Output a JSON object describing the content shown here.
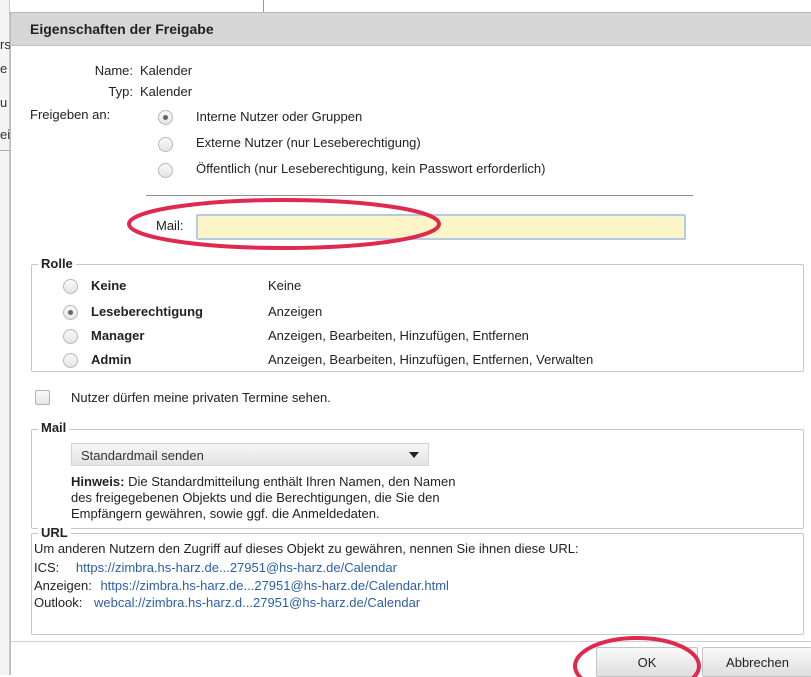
{
  "background": {
    "fragments": [
      "rs",
      "e",
      "u",
      "ei"
    ]
  },
  "dialog": {
    "title": "Eigenschaften der Freigabe",
    "name_label": "Name:",
    "name_value": "Kalender",
    "type_label": "Typ:",
    "type_value": "Kalender",
    "share_label": "Freigeben an:",
    "share_options": [
      {
        "label": "Interne Nutzer oder Gruppen",
        "selected": true
      },
      {
        "label": "Externe Nutzer (nur Leseberechtigung)",
        "selected": false
      },
      {
        "label": "Öffentlich (nur Leseberechtigung, kein Passwort erforderlich)",
        "selected": false
      }
    ],
    "mail_label": "Mail:",
    "mail_value": "",
    "role": {
      "legend": "Rolle",
      "options": [
        {
          "name": "Keine",
          "desc": "Keine",
          "selected": false
        },
        {
          "name": "Leseberechtigung",
          "desc": "Anzeigen",
          "selected": true
        },
        {
          "name": "Manager",
          "desc": "Anzeigen, Bearbeiten, Hinzufügen, Entfernen",
          "selected": false
        },
        {
          "name": "Admin",
          "desc": "Anzeigen, Bearbeiten, Hinzufügen, Entfernen, Verwalten",
          "selected": false
        }
      ]
    },
    "private_checkbox_label": "Nutzer dürfen meine privaten Termine sehen.",
    "private_checked": false,
    "mail_section": {
      "legend": "Mail",
      "select_value": "Standardmail senden",
      "hint_bold": "Hinweis:",
      "hint_line1": " Die Standardmitteilung enthält Ihren Namen, den Namen",
      "hint_line2": "des freigegebenen Objekts und die Berechtigungen, die Sie den",
      "hint_line3": "Empfängern gewähren, sowie ggf. die Anmeldedaten."
    },
    "url_section": {
      "legend": "URL",
      "intro": "Um anderen Nutzern den Zugriff auf dieses Objekt zu gewähren, nennen Sie ihnen diese URL:",
      "ics_label": "ICS:",
      "ics_url": "https://zimbra.hs-harz.de...27951@hs-harz.de/Calendar",
      "view_label": "Anzeigen:",
      "view_url": "https://zimbra.hs-harz.de...27951@hs-harz.de/Calendar.html",
      "outlook_label": "Outlook:",
      "outlook_url": "webcal://zimbra.hs-harz.d...27951@hs-harz.de/Calendar"
    },
    "buttons": {
      "ok": "OK",
      "cancel": "Abbrechen"
    }
  },
  "colors": {
    "annotation": "#e0294f",
    "mail_input_bg": "#fcf5c8",
    "link": "#2b5fa8",
    "titlebar": "#d6d6d6"
  }
}
